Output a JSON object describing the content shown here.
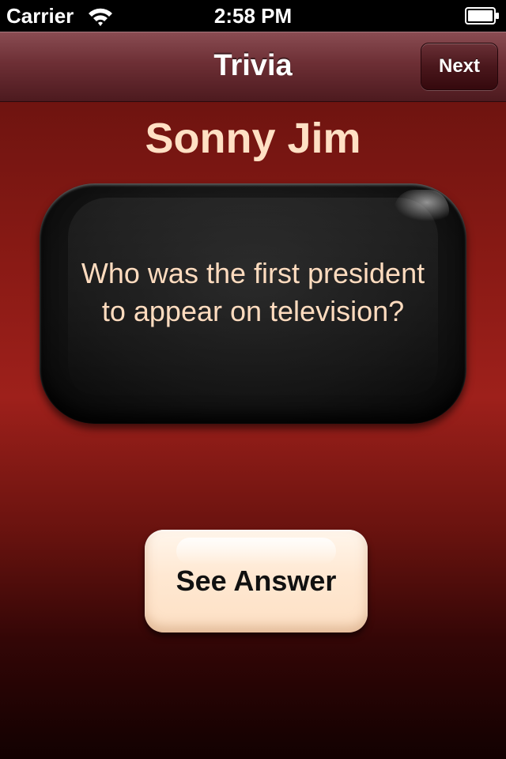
{
  "status_bar": {
    "carrier": "Carrier",
    "time": "2:58 PM"
  },
  "nav": {
    "title": "Trivia",
    "next_label": "Next"
  },
  "main": {
    "player_name": "Sonny Jim",
    "question": "Who was the first president to appear on television?",
    "see_answer_label": "See Answer"
  },
  "colors": {
    "accent_text": "#ffe0c4",
    "background_red": "#9e201b",
    "nav_maroon": "#6d2f35",
    "card_black": "#151515",
    "button_cream": "#ffe8d2"
  },
  "icons": {
    "wifi": "wifi-icon",
    "battery": "battery-icon"
  }
}
